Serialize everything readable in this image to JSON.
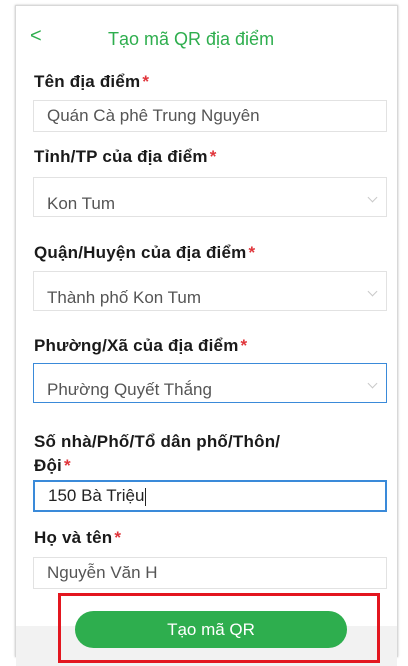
{
  "header": {
    "back_symbol": "<",
    "title": "Tạo mã QR địa điểm"
  },
  "required_mark": "*",
  "fields": {
    "place_name": {
      "label": "Tên địa điểm",
      "value": "Quán Cà phê Trung Nguyên"
    },
    "province": {
      "label": "Tỉnh/TP của địa điểm",
      "value": "Kon Tum"
    },
    "district": {
      "label": "Quận/Huyện của địa điểm",
      "value": "Thành phố Kon Tum"
    },
    "ward": {
      "label": "Phường/Xã của địa điểm",
      "value": "Phường Quyết Thắng"
    },
    "address": {
      "label_line1": "Số nhà/Phố/Tổ dân phố/Thôn/",
      "label_line2": "Đội",
      "value": "150 Bà Triệu"
    },
    "full_name": {
      "label": "Họ và tên",
      "value": "Nguyễn Văn H"
    }
  },
  "actions": {
    "create_qr": "Tạo mã QR"
  },
  "colors": {
    "accent": "#2eae4e",
    "required": "#e0343a",
    "focus": "#3a8ad9",
    "highlight_box": "#e3161f"
  },
  "icons": {
    "back": "chevron-left-icon",
    "dropdown": "chevron-down-icon"
  }
}
